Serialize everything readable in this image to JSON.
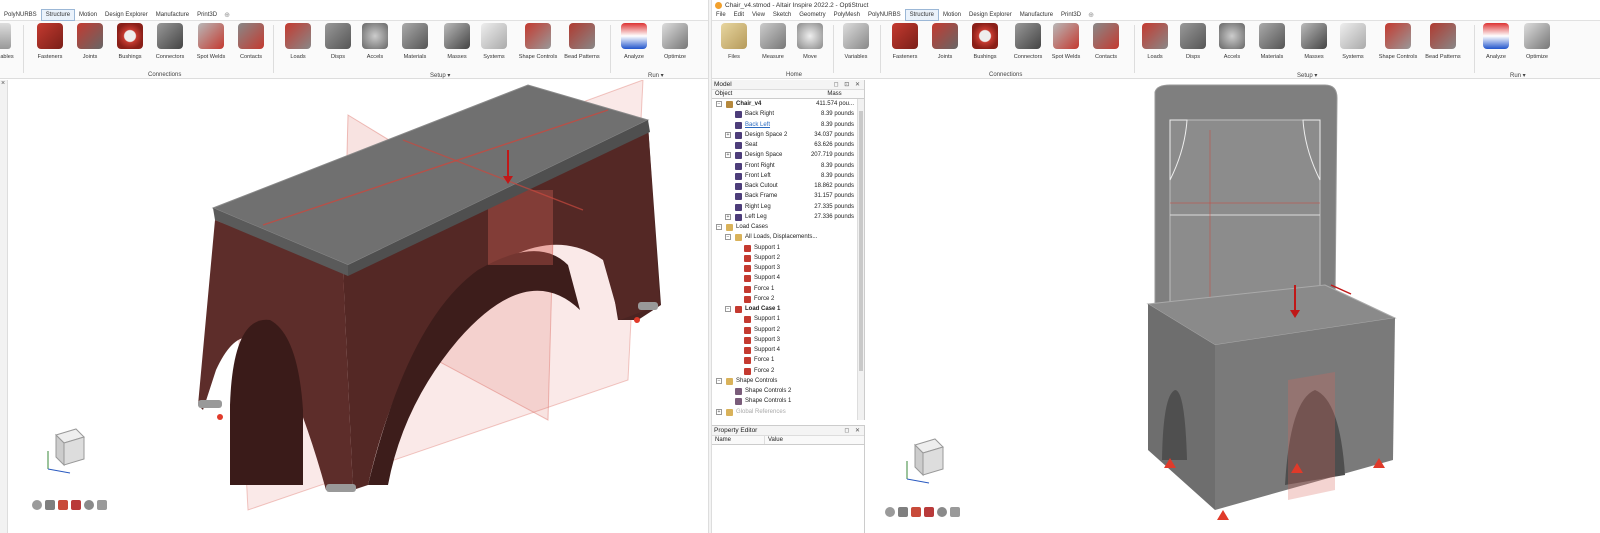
{
  "left": {
    "menu_tabs": [
      "PolyNURBS",
      "Structure",
      "Motion",
      "Design Explorer",
      "Manufacture",
      "Print3D"
    ],
    "active_tab": "Structure",
    "clipped_tool_label": "ables",
    "tools": [
      {
        "label": "Fasteners",
        "icon": "fasteners-icon"
      },
      {
        "label": "Joints",
        "icon": "joints-icon"
      },
      {
        "label": "Bushings",
        "icon": "bushings-icon"
      },
      {
        "label": "Connectors",
        "icon": "connectors-icon"
      },
      {
        "label": "Spot Welds",
        "icon": "spot-welds-icon"
      },
      {
        "label": "Contacts",
        "icon": "contacts-icon"
      },
      {
        "label": "Loads",
        "icon": "loads-icon"
      },
      {
        "label": "Disps",
        "icon": "disps-icon"
      },
      {
        "label": "Accels",
        "icon": "accels-icon"
      },
      {
        "label": "Materials",
        "icon": "materials-icon"
      },
      {
        "label": "Masses",
        "icon": "masses-icon"
      },
      {
        "label": "Systems",
        "icon": "systems-icon"
      },
      {
        "label": "Shape Controls",
        "icon": "shape-controls-icon"
      },
      {
        "label": "Bead Patterns",
        "icon": "bead-patterns-icon"
      },
      {
        "label": "Analyze",
        "icon": "analyze-icon"
      },
      {
        "label": "Optimize",
        "icon": "optimize-icon"
      }
    ],
    "groups": {
      "connections": "Connections",
      "setup": "Setup",
      "run": "Run"
    }
  },
  "right": {
    "window_title": "Chair_v4.stmod - Altair Inspire 2022.2 - OptiStruct",
    "menu_tabs": [
      "File",
      "Edit",
      "View",
      "Sketch",
      "Geometry",
      "PolyMesh",
      "PolyNURBS",
      "Structure",
      "Motion",
      "Design Explorer",
      "Manufacture",
      "Print3D"
    ],
    "active_tab": "Structure",
    "home_tools": [
      {
        "label": "Files",
        "icon": "files-icon"
      },
      {
        "label": "Measure",
        "icon": "measure-icon"
      },
      {
        "label": "Move",
        "icon": "move-icon"
      }
    ],
    "variables_label": "Variables",
    "tools": [
      {
        "label": "Fasteners",
        "icon": "fasteners-icon"
      },
      {
        "label": "Joints",
        "icon": "joints-icon"
      },
      {
        "label": "Bushings",
        "icon": "bushings-icon"
      },
      {
        "label": "Connectors",
        "icon": "connectors-icon"
      },
      {
        "label": "Spot Welds",
        "icon": "spot-welds-icon"
      },
      {
        "label": "Contacts",
        "icon": "contacts-icon"
      },
      {
        "label": "Loads",
        "icon": "loads-icon"
      },
      {
        "label": "Disps",
        "icon": "disps-icon"
      },
      {
        "label": "Accels",
        "icon": "accels-icon"
      },
      {
        "label": "Materials",
        "icon": "materials-icon"
      },
      {
        "label": "Masses",
        "icon": "masses-icon"
      },
      {
        "label": "Systems",
        "icon": "systems-icon"
      },
      {
        "label": "Shape Controls",
        "icon": "shape-controls-icon"
      },
      {
        "label": "Bead Patterns",
        "icon": "bead-patterns-icon"
      },
      {
        "label": "Analyze",
        "icon": "analyze-icon"
      },
      {
        "label": "Optimize",
        "icon": "optimize-icon"
      }
    ],
    "groups": {
      "home": "Home",
      "connections": "Connections",
      "setup": "Setup",
      "run": "Run"
    },
    "model_panel": {
      "title": "Model",
      "col_object": "Object",
      "col_mass": "Mass",
      "tree": [
        {
          "label": "Chair_v4",
          "value": "411.574 pou...",
          "style": "bold",
          "icon": "assembly-icon"
        },
        {
          "label": "Back Right",
          "value": "8.39 pounds",
          "icon": "part-icon"
        },
        {
          "label": "Back Left",
          "value": "8.39 pounds",
          "style": "link",
          "icon": "part-icon"
        },
        {
          "label": "Design Space 2",
          "value": "34.037 pounds",
          "icon": "part-icon"
        },
        {
          "label": "Seat",
          "value": "63.626 pounds",
          "icon": "part-icon"
        },
        {
          "label": "Design Space",
          "value": "207.719 pounds",
          "icon": "part-icon"
        },
        {
          "label": "Front Right",
          "value": "8.39 pounds",
          "icon": "part-icon"
        },
        {
          "label": "Front Left",
          "value": "8.39 pounds",
          "icon": "part-icon"
        },
        {
          "label": "Back Cutout",
          "value": "18.862 pounds",
          "icon": "part-icon"
        },
        {
          "label": "Back Frame",
          "value": "31.157 pounds",
          "icon": "part-icon"
        },
        {
          "label": "Right Leg",
          "value": "27.335 pounds",
          "icon": "part-icon"
        },
        {
          "label": "Left Leg",
          "value": "27.336 pounds",
          "icon": "part-icon"
        },
        {
          "label": "Load Cases",
          "value": "",
          "icon": "folder-icon"
        },
        {
          "label": "All Loads, Displacements...",
          "value": "",
          "icon": "folder-icon"
        },
        {
          "label": "Support 1",
          "value": "",
          "icon": "support-icon"
        },
        {
          "label": "Support 2",
          "value": "",
          "icon": "support-icon"
        },
        {
          "label": "Support 3",
          "value": "",
          "icon": "support-icon"
        },
        {
          "label": "Support 4",
          "value": "",
          "icon": "support-icon"
        },
        {
          "label": "Force 1",
          "value": "",
          "icon": "force-icon"
        },
        {
          "label": "Force 2",
          "value": "",
          "icon": "force-icon"
        },
        {
          "label": "Load Case 1",
          "value": "",
          "style": "bold",
          "icon": "loadcase-icon"
        },
        {
          "label": "Support 1",
          "value": "",
          "icon": "support-icon"
        },
        {
          "label": "Support 2",
          "value": "",
          "icon": "support-icon"
        },
        {
          "label": "Support 3",
          "value": "",
          "icon": "support-icon"
        },
        {
          "label": "Support 4",
          "value": "",
          "icon": "support-icon"
        },
        {
          "label": "Force 1",
          "value": "",
          "icon": "force-icon"
        },
        {
          "label": "Force 2",
          "value": "",
          "icon": "force-icon"
        },
        {
          "label": "Shape Controls",
          "value": "",
          "icon": "folder-icon"
        },
        {
          "label": "Shape Controls 2",
          "value": "",
          "icon": "shape-control-icon"
        },
        {
          "label": "Shape Controls 1",
          "value": "",
          "icon": "shape-control-icon"
        },
        {
          "label": "Global References",
          "value": "",
          "style": "grey",
          "icon": "folder-icon"
        }
      ]
    },
    "property_editor": {
      "title": "Property Editor",
      "col_name": "Name",
      "col_value": "Value"
    }
  },
  "colors": {
    "accent": "#9bb7d6",
    "part_maroon": "#5a2b28",
    "part_grey": "#7d7d7d",
    "plane_red": "#d9635a",
    "support_red": "#e03a2a"
  }
}
